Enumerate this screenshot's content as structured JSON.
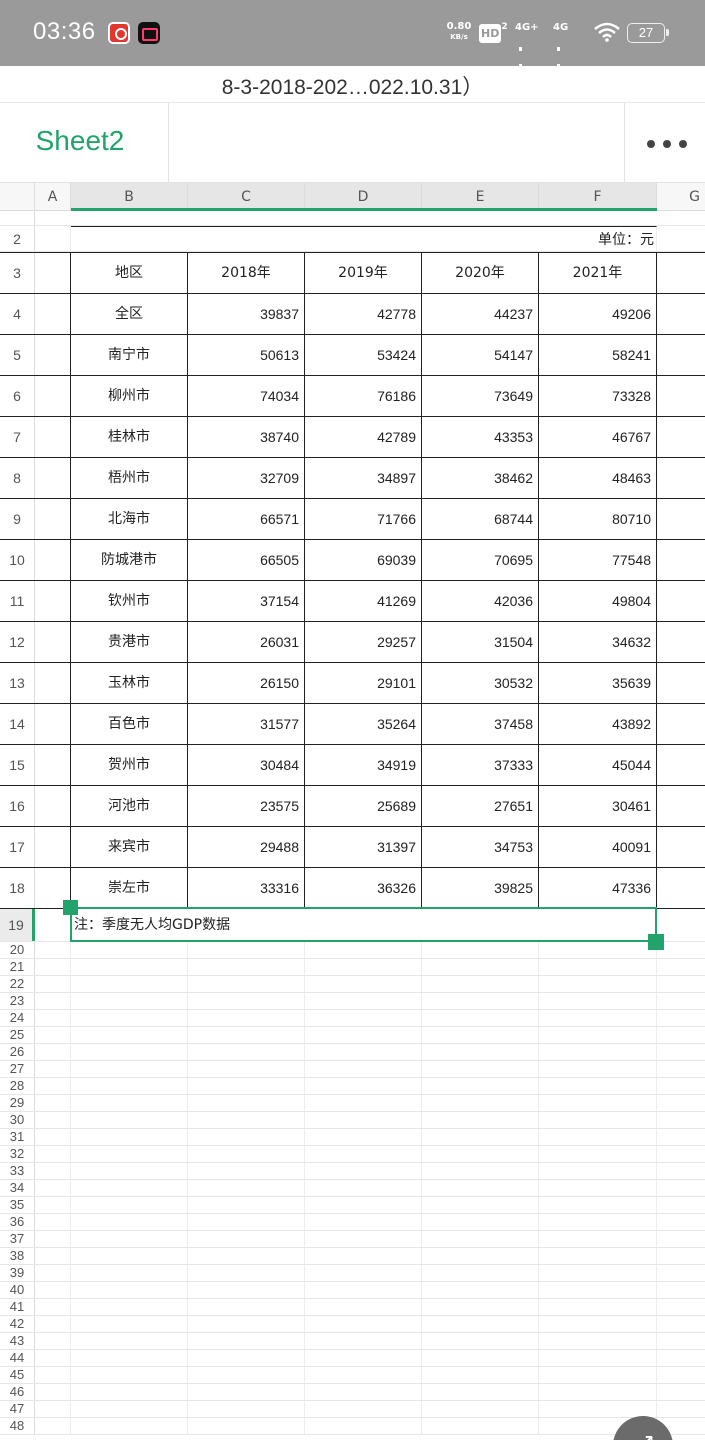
{
  "status_bar": {
    "time": "03:36",
    "net_speed_value": "0.80",
    "net_speed_unit": "KB/s",
    "hd_label": "HD",
    "hd_sub": "2",
    "signal1_label": "4G+",
    "signal2_label": "4G",
    "battery_level": "27"
  },
  "document": {
    "title": "8-3-2018-202…022.10.31）"
  },
  "sheet_bar": {
    "active_sheet": "Sheet2"
  },
  "grid": {
    "columns": [
      "A",
      "B",
      "C",
      "D",
      "E",
      "F",
      "G"
    ],
    "unit_label": "单位：元",
    "header_row": {
      "row": "3",
      "region": "地区",
      "y2018": "2018年",
      "y2019": "2019年",
      "y2020": "2020年",
      "y2021": "2021年"
    },
    "data_rows": [
      {
        "row": "4",
        "region": "全区",
        "y2018": "39837",
        "y2019": "42778",
        "y2020": "44237",
        "y2021": "49206"
      },
      {
        "row": "5",
        "region": "南宁市",
        "y2018": "50613",
        "y2019": "53424",
        "y2020": "54147",
        "y2021": "58241"
      },
      {
        "row": "6",
        "region": "柳州市",
        "y2018": "74034",
        "y2019": "76186",
        "y2020": "73649",
        "y2021": "73328"
      },
      {
        "row": "7",
        "region": "桂林市",
        "y2018": "38740",
        "y2019": "42789",
        "y2020": "43353",
        "y2021": "46767"
      },
      {
        "row": "8",
        "region": "梧州市",
        "y2018": "32709",
        "y2019": "34897",
        "y2020": "38462",
        "y2021": "48463"
      },
      {
        "row": "9",
        "region": "北海市",
        "y2018": "66571",
        "y2019": "71766",
        "y2020": "68744",
        "y2021": "80710"
      },
      {
        "row": "10",
        "region": "防城港市",
        "y2018": "66505",
        "y2019": "69039",
        "y2020": "70695",
        "y2021": "77548"
      },
      {
        "row": "11",
        "region": "钦州市",
        "y2018": "37154",
        "y2019": "41269",
        "y2020": "42036",
        "y2021": "49804"
      },
      {
        "row": "12",
        "region": "贵港市",
        "y2018": "26031",
        "y2019": "29257",
        "y2020": "31504",
        "y2021": "34632"
      },
      {
        "row": "13",
        "region": "玉林市",
        "y2018": "26150",
        "y2019": "29101",
        "y2020": "30532",
        "y2021": "35639"
      },
      {
        "row": "14",
        "region": "百色市",
        "y2018": "31577",
        "y2019": "35264",
        "y2020": "37458",
        "y2021": "43892"
      },
      {
        "row": "15",
        "region": "贺州市",
        "y2018": "30484",
        "y2019": "34919",
        "y2020": "37333",
        "y2021": "45044"
      },
      {
        "row": "16",
        "region": "河池市",
        "y2018": "23575",
        "y2019": "25689",
        "y2020": "27651",
        "y2021": "30461"
      },
      {
        "row": "17",
        "region": "来宾市",
        "y2018": "29488",
        "y2019": "31397",
        "y2020": "34753",
        "y2021": "40091"
      },
      {
        "row": "18",
        "region": "崇左市",
        "y2018": "33316",
        "y2019": "36326",
        "y2020": "39825",
        "y2021": "47336"
      }
    ],
    "note": "注：季度无人均GDP数据",
    "note_row": "19",
    "unit_row": "2",
    "empty_rows": [
      "20",
      "21",
      "22",
      "23",
      "24",
      "25",
      "26",
      "27",
      "28",
      "29",
      "30",
      "31",
      "32",
      "33",
      "34",
      "35",
      "36",
      "37",
      "38",
      "39",
      "40",
      "41",
      "42",
      "43",
      "44",
      "45",
      "46",
      "47",
      "48"
    ]
  },
  "colors": {
    "accent": "#21a36b",
    "status_bar_bg": "#9a9a9a"
  },
  "icons": {
    "more": "more-dots-icon",
    "fab": "expand-arrow-icon",
    "wifi": "wifi-icon"
  }
}
